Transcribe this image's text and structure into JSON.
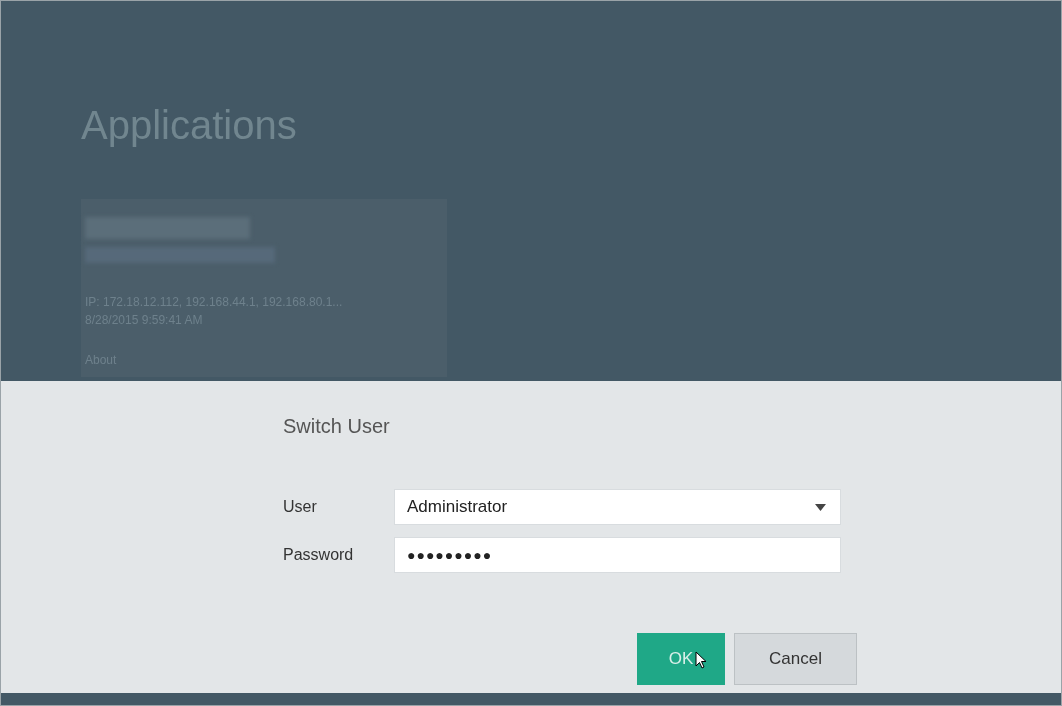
{
  "page": {
    "title": "Applications"
  },
  "server_card": {
    "ip": "IP: 172.18.12.112, 192.168.44.1, 192.168.80.1...",
    "timestamp": "8/28/2015 9:59:41 AM",
    "link": "About"
  },
  "dialog": {
    "title": "Switch User",
    "fields": [
      {
        "kind": "dropdown",
        "label": "User",
        "value": "Administrator"
      },
      {
        "kind": "password",
        "label": "Password",
        "value": "●●●●●●●●●"
      }
    ],
    "buttons": [
      {
        "label": "OK",
        "primary": true
      },
      {
        "label": "Cancel",
        "primary": false
      }
    ]
  }
}
